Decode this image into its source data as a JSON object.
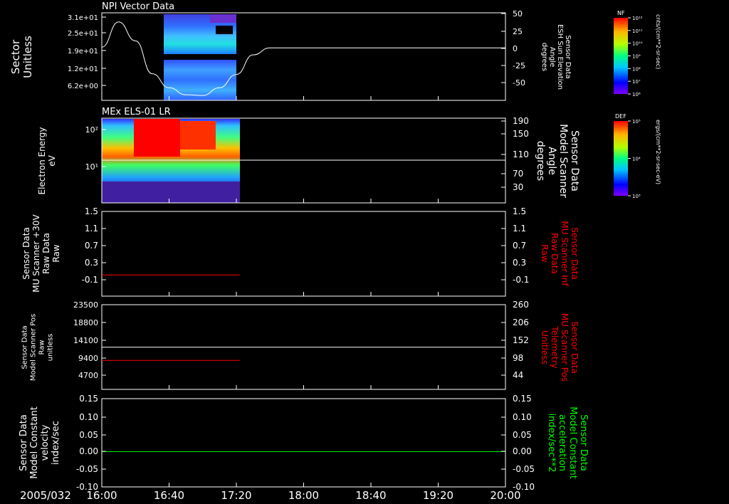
{
  "date_label": "2005/032",
  "time_ticks": [
    "16:00",
    "16:40",
    "17:20",
    "18:00",
    "18:40",
    "19:20",
    "20:00"
  ],
  "colors": {
    "background": "#000000",
    "axes": "#ffffff",
    "red_trace": "#ff0000",
    "green_trace": "#00ff00",
    "white_trace": "#ffffff"
  },
  "chart_data": [
    {
      "type": "heatmap",
      "title": "NPI Vector Data",
      "left_label": [
        "Sector",
        "Unitless"
      ],
      "left_ticks": [
        "3.1e+01",
        "2.5e+01",
        "1.9e+01",
        "1.2e+01",
        "6.2e+00"
      ],
      "right_label": [
        "Sensor Data",
        "ESH Sun Elevation",
        "Angle",
        "degrees"
      ],
      "right_ticks": [
        "50",
        "25",
        "0",
        "-25",
        "-50"
      ],
      "right_ylim": [
        -75,
        50
      ],
      "overlay_series": {
        "name": "ESH Sun Elevation Angle",
        "times": [
          "16:00",
          "16:10",
          "16:20",
          "16:30",
          "16:40",
          "16:50",
          "17:00",
          "17:10",
          "17:20",
          "17:30",
          "17:40",
          "20:00"
        ],
        "values": [
          1,
          37,
          10,
          -37,
          -57,
          -67,
          -68,
          -57,
          -38,
          -10,
          0,
          0
        ]
      },
      "colorbar": {
        "label": "NF",
        "units": "cnts/(cm**2-sr-sec)",
        "ticks": [
          "10¹²",
          "10¹¹",
          "10¹⁰",
          "10⁹",
          "10⁸",
          "10⁷",
          "10⁶"
        ]
      }
    },
    {
      "type": "heatmap",
      "title": "MEx ELS-01 LR",
      "left_label": [
        "Electron Energy",
        "eV"
      ],
      "left_ticks": [
        "10²",
        "10¹"
      ],
      "right_label": [
        "Sensor Data",
        "Model Scanner",
        "Angle",
        "degrees"
      ],
      "right_ticks": [
        "190",
        "150",
        "110",
        "70",
        "30"
      ],
      "right_ylim": [
        0,
        190
      ],
      "overlay_series": {
        "name": "Model Scanner Angle",
        "value": 90
      },
      "colorbar": {
        "label": "DEF",
        "units": "ergs/(cm**2-sr-sec-eV)",
        "ticks": [
          "10⁵",
          "10⁴",
          "10³"
        ]
      }
    },
    {
      "type": "line",
      "left_label": [
        "Sensor Data",
        "MU Scanner +30V",
        "Raw Data",
        "Raw"
      ],
      "left_ticks": [
        "1.5",
        "1.1",
        "0.7",
        "0.3",
        "-0.1"
      ],
      "right_label": [
        "Sensor Data",
        "MU Scanner Inf",
        "Raw Data",
        "Raw"
      ],
      "right_ticks": [
        "1.5",
        "1.1",
        "0.7",
        "0.3",
        "-0.1"
      ],
      "ylim": [
        -0.5,
        1.5
      ],
      "series": [
        {
          "color": "red",
          "x": [
            "16:00",
            "17:22"
          ],
          "y": [
            0.0,
            0.0
          ]
        }
      ]
    },
    {
      "type": "line",
      "left_label": [
        "Sensor Data",
        "Model Scanner Pos",
        "Raw",
        "unitless"
      ],
      "left_ticks": [
        "23500",
        "18800",
        "14100",
        "9400",
        "4700"
      ],
      "right_label": [
        "Sensor Data",
        "MU Scanner Pos",
        "Telemetry",
        "Unitless"
      ],
      "right_ticks": [
        "260",
        "206",
        "152",
        "98",
        "44"
      ],
      "ylim": [
        0,
        23500
      ],
      "series": [
        {
          "color": "white",
          "x": [
            "16:00",
            "20:00"
          ],
          "y": [
            11700,
            11700
          ]
        },
        {
          "color": "red",
          "x": [
            "16:00",
            "17:22"
          ],
          "y": [
            8050,
            8050
          ]
        }
      ]
    },
    {
      "type": "line",
      "left_label": [
        "Sensor Data",
        "Model Constant",
        "velocity",
        "index/sec"
      ],
      "left_ticks": [
        "0.15",
        "0.10",
        "0.05",
        "0.00",
        "-0.05",
        "-0.10"
      ],
      "right_label": [
        "Sensor Data",
        "Model Constant",
        "acceleration",
        "index/sec**2"
      ],
      "right_ticks": [
        "0.15",
        "0.10",
        "0.05",
        "0.00",
        "-0.05",
        "-0.10"
      ],
      "ylim": [
        -0.1,
        0.15
      ],
      "series": [
        {
          "color": "green",
          "x": [
            "16:00",
            "20:00"
          ],
          "y": [
            0.0,
            0.0
          ]
        }
      ]
    }
  ]
}
